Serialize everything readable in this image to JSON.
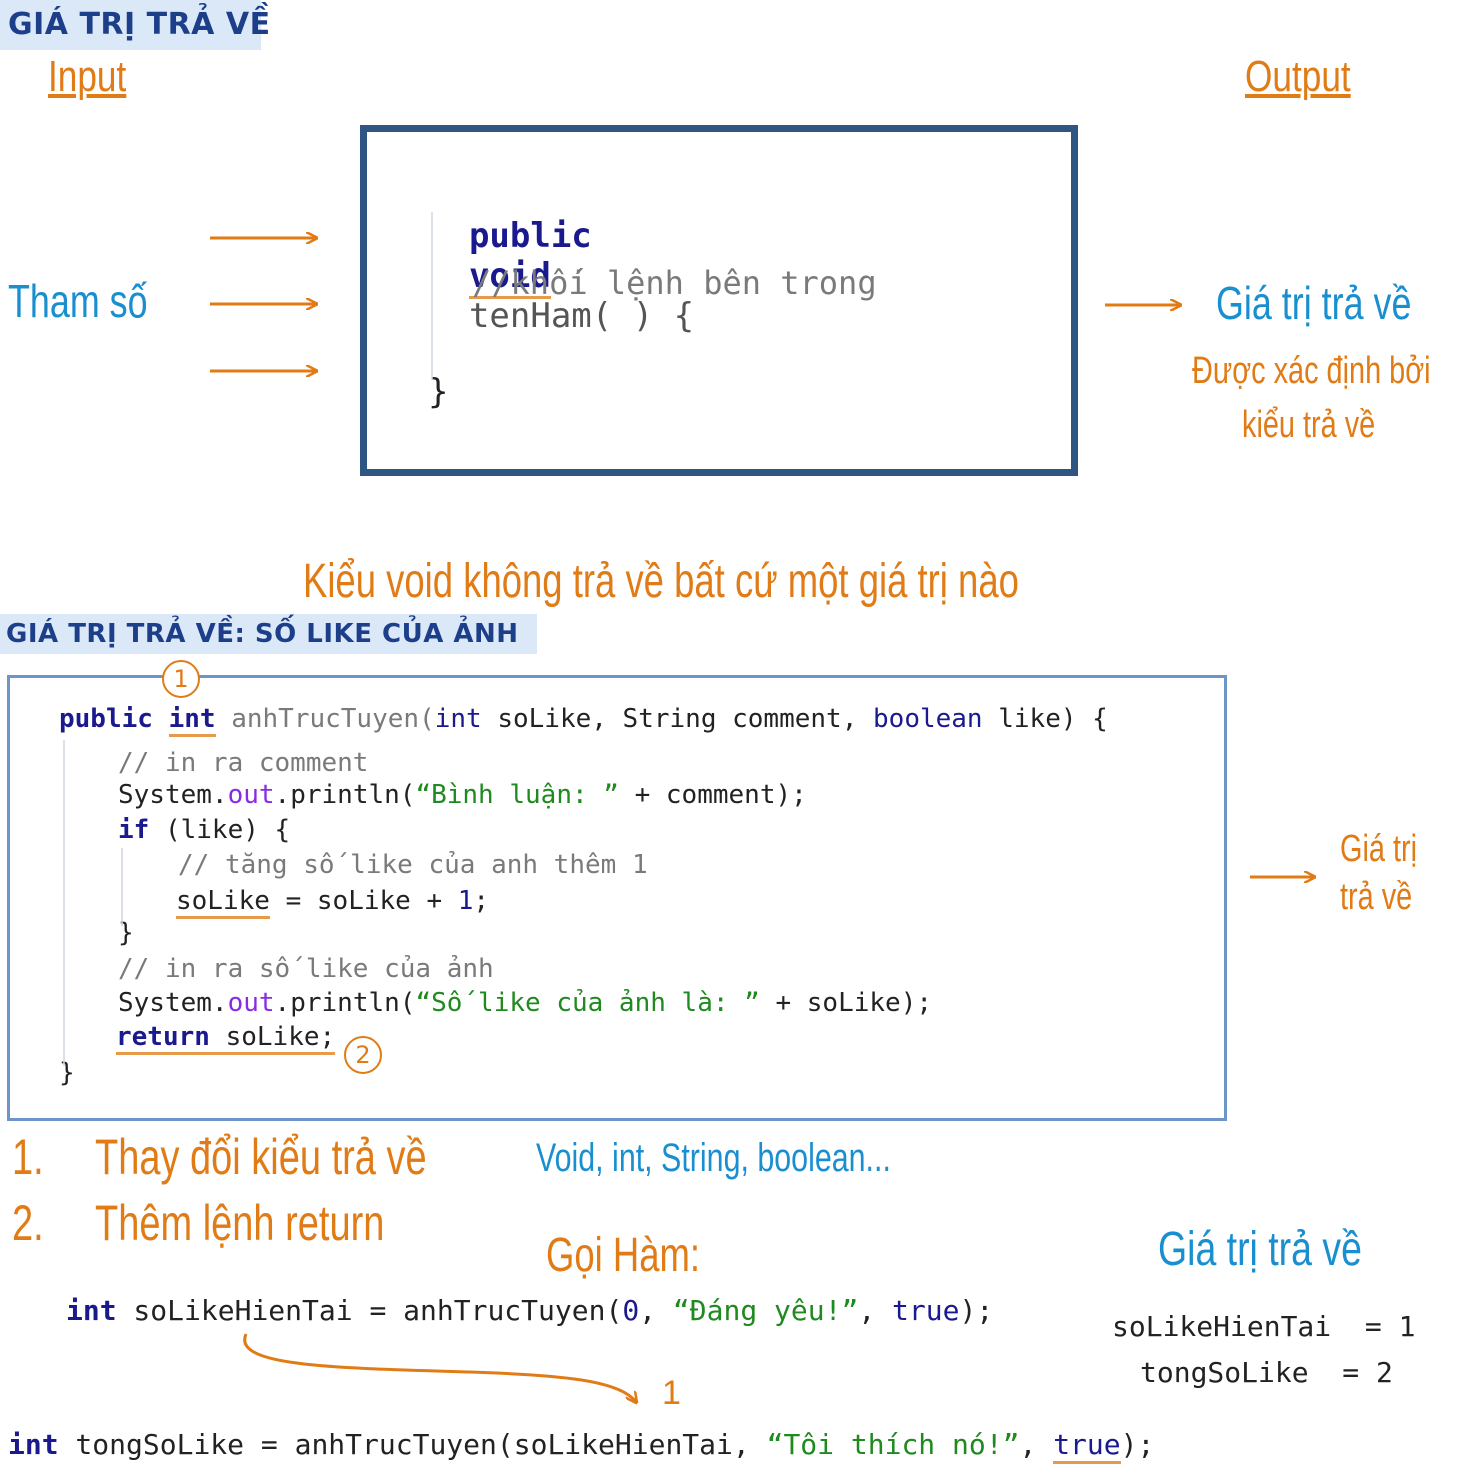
{
  "header1": "GIÁ TRỊ TRẢ VỀ",
  "input_label": "Input",
  "output_label": "Output",
  "param_label": "Tham số",
  "return_label": "Giá trị trả về",
  "determined_line1": "Được xác định bởi",
  "determined_line2": "kiểu trả về",
  "code1": {
    "public": "public",
    "void": "void",
    "signature": "tenHam( ) {",
    "comment": "//khối lệnh bên trong",
    "close": "}"
  },
  "void_note": "Kiểu void không trả về bất cứ một giá trị nào",
  "header2": "GIÁ TRỊ TRẢ VỀ: SỐ LIKE CỦA ẢNH",
  "marker1": "1",
  "marker2": "2",
  "code2": {
    "kw_public": "public",
    "kw_int": "int",
    "fn_name": "anhTrucTuyen(",
    "kw_int2": "int",
    "params_a": " soLike, String comment, ",
    "kw_boolean": "boolean",
    "params_b": " like) {",
    "comment1": "// in ra comment",
    "sys1": "System.",
    "out1": "out",
    "println1": ".println(",
    "str1": "“Bình luận: ”",
    "rest1": " + comment);",
    "kw_if": "if",
    "if_rest": " (like) {",
    "comment2": "// tăng số like của anh thêm 1",
    "solike": "soLike",
    "assign": " = soLike + ",
    "one": "1",
    "semi": ";",
    "close_if": "}",
    "comment3": "// in ra số like của ảnh",
    "sys2": "System.",
    "out2": "out",
    "println2": ".println(",
    "str2": "“Số like của ảnh là: ”",
    "rest2": " + soLike);",
    "kw_return": "return",
    "ret_rest": " soLike;",
    "close_fn": "}"
  },
  "side_return_line1": "Giá trị",
  "side_return_line2": "trả về",
  "step1_num": "1.",
  "step1_text": "Thay đổi kiểu trả về",
  "step2_num": "2.",
  "step2_text": "Thêm lệnh return",
  "types_text": "Void, int, String, boolean...",
  "call_label": "Gọi Hàm:",
  "call_return_label": "Giá trị trả về",
  "call1": {
    "kw_int": "int",
    "lhs": " soLikeHienTai = anhTrucTuyen(",
    "zero": "0",
    "comma1": ", ",
    "str": "“Đáng yêu!”",
    "comma2": ", ",
    "kw_true": "true",
    "end": ");"
  },
  "result1": "soLikeHienTai  = 1",
  "result2": "tongSoLike  = 2",
  "arrow_value": "1",
  "call2": {
    "kw_int": "int",
    "lhs": " tongSoLike = anhTrucTuyen(soLikeHienTai, ",
    "str": "“Tôi thích nó!”",
    "comma": ", ",
    "kw_true": "true",
    "end": ");"
  },
  "colors": {
    "accent_orange": "#e07b16",
    "accent_blue": "#1a8fd0",
    "box_dark_blue": "#2f5583",
    "box_light_blue": "#6e95c8",
    "header_bg": "#dbe8f7",
    "header_text": "#1d3f8a"
  }
}
